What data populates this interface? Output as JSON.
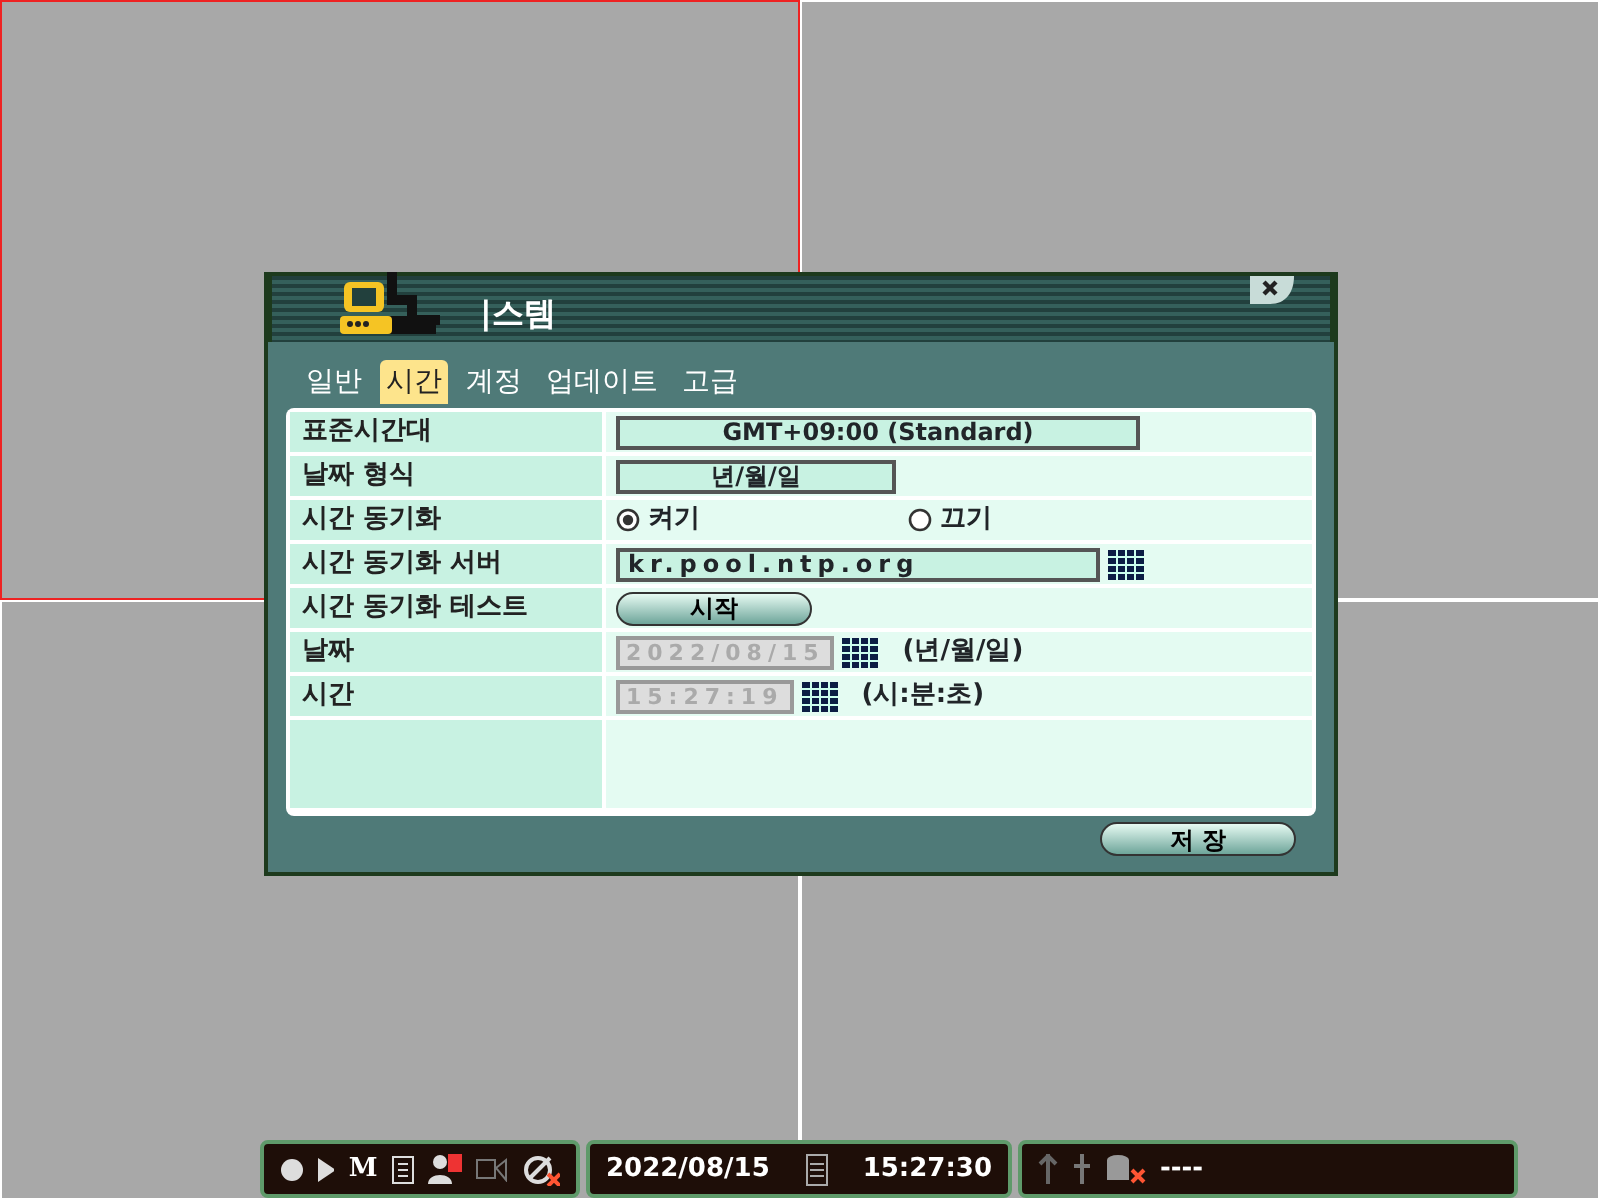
{
  "views": [
    {
      "selected": true
    },
    {
      "selected": false
    },
    {
      "selected": false
    },
    {
      "selected": false
    }
  ],
  "dialog": {
    "title": "|스템",
    "tabs": [
      {
        "label": "일반",
        "selected": false
      },
      {
        "label": "시간",
        "selected": true
      },
      {
        "label": "계정",
        "selected": false
      },
      {
        "label": "업데이트",
        "selected": false
      },
      {
        "label": "고급",
        "selected": false
      }
    ],
    "rows": [
      {
        "label": "표준시간대",
        "kind": "select",
        "value": "GMT+09:00 (Standard)"
      },
      {
        "label": "날짜 형식",
        "kind": "select",
        "value": "년/월/일"
      },
      {
        "label": "시간 동기화",
        "kind": "radio",
        "options": [
          {
            "label": "켜기",
            "selected": true
          },
          {
            "label": "끄기",
            "selected": false
          }
        ]
      },
      {
        "label": "시간 동기화 서버",
        "kind": "text",
        "value": "kr.pool.ntp.org"
      },
      {
        "label": "시간 동기화 테스트",
        "kind": "button",
        "value": "시작"
      },
      {
        "label": "날짜",
        "kind": "disabled",
        "value": "2022/08/15",
        "hint": "(년/월/일)"
      },
      {
        "label": "시간",
        "kind": "disabled",
        "value": "15:27:19",
        "hint": "(시:분:초)"
      }
    ],
    "save_button": "저 장"
  },
  "status_bar": {
    "mode": "M",
    "date": "2022/08/15",
    "time": "15:27:30",
    "storage": "----"
  }
}
